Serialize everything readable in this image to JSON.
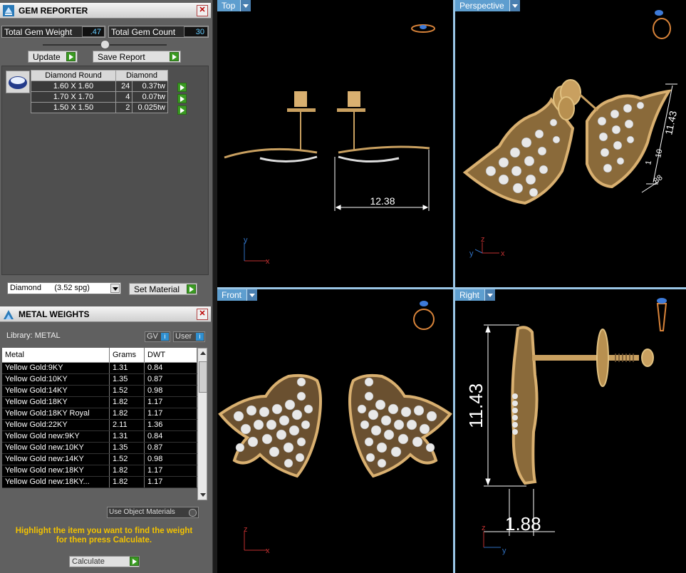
{
  "gem_reporter": {
    "title": "GEM REPORTER",
    "total_gem_weight_label": "Total Gem Weight",
    "total_gem_weight_value": ".47",
    "total_gem_count_label": "Total Gem Count",
    "total_gem_count_value": "30",
    "update_label": "Update",
    "save_report_label": "Save Report",
    "table_headers": [
      "Diamond Round",
      "Diamond"
    ],
    "rows": [
      {
        "size": "1.60 X 1.60",
        "count": "24",
        "weight": "0.37tw"
      },
      {
        "size": "1.70 X 1.70",
        "count": "4",
        "weight": "0.07tw"
      },
      {
        "size": "1.50 X 1.50",
        "count": "2",
        "weight": "0.025tw"
      }
    ],
    "material_select": "Diamond      (3.52 spg)",
    "set_material_label": "Set Material"
  },
  "metal_weights": {
    "title": "METAL WEIGHTS",
    "library_label": "Library: METAL",
    "gv_label": "GV",
    "user_label": "User",
    "headers": [
      "Metal",
      "Grams",
      "DWT"
    ],
    "rows": [
      {
        "metal": "Yellow Gold:9KY",
        "grams": "1.31",
        "dwt": "0.84"
      },
      {
        "metal": "Yellow Gold:10KY",
        "grams": "1.35",
        "dwt": "0.87"
      },
      {
        "metal": "Yellow Gold:14KY",
        "grams": "1.52",
        "dwt": "0.98"
      },
      {
        "metal": "Yellow Gold:18KY",
        "grams": "1.82",
        "dwt": "1.17"
      },
      {
        "metal": "Yellow Gold:18KY Royal",
        "grams": "1.82",
        "dwt": "1.17"
      },
      {
        "metal": "Yellow Gold:22KY",
        "grams": "2.11",
        "dwt": "1.36"
      },
      {
        "metal": "Yellow Gold new:9KY",
        "grams": "1.31",
        "dwt": "0.84"
      },
      {
        "metal": "Yellow Gold new:10KY",
        "grams": "1.35",
        "dwt": "0.87"
      },
      {
        "metal": "Yellow Gold new:14KY",
        "grams": "1.52",
        "dwt": "0.98"
      },
      {
        "metal": "Yellow Gold new:18KY",
        "grams": "1.82",
        "dwt": "1.17"
      },
      {
        "metal": "Yellow Gold new:18KY...",
        "grams": "1.82",
        "dwt": "1.17"
      }
    ],
    "use_object_materials_label": "Use Object Materials",
    "hint_line1": "Highlight the item you want to find the weight",
    "hint_line2": "for then press Calculate.",
    "calculate_label": "Calculate"
  },
  "viewports": {
    "top": {
      "label": "Top",
      "dimension": "12.38",
      "axis_x": "x",
      "axis_y": "y"
    },
    "perspective": {
      "label": "Perspective",
      "dims": [
        "11.43",
        "10",
        "1",
        ".88"
      ],
      "axis_x": "x",
      "axis_y": "y",
      "axis_z": "z"
    },
    "front": {
      "label": "Front",
      "axis_x": "x",
      "axis_z": "z"
    },
    "right": {
      "label": "Right",
      "dim_height": "11.43",
      "dim_width": "1.88",
      "axis_y": "y",
      "axis_z": "z"
    }
  },
  "colors": {
    "gold": "#c9a060",
    "viewport_bg": "#000000",
    "accent_blue": "#5e9ecf",
    "hint_yellow": "#f2c200",
    "green_arrow": "#3a9a22"
  }
}
